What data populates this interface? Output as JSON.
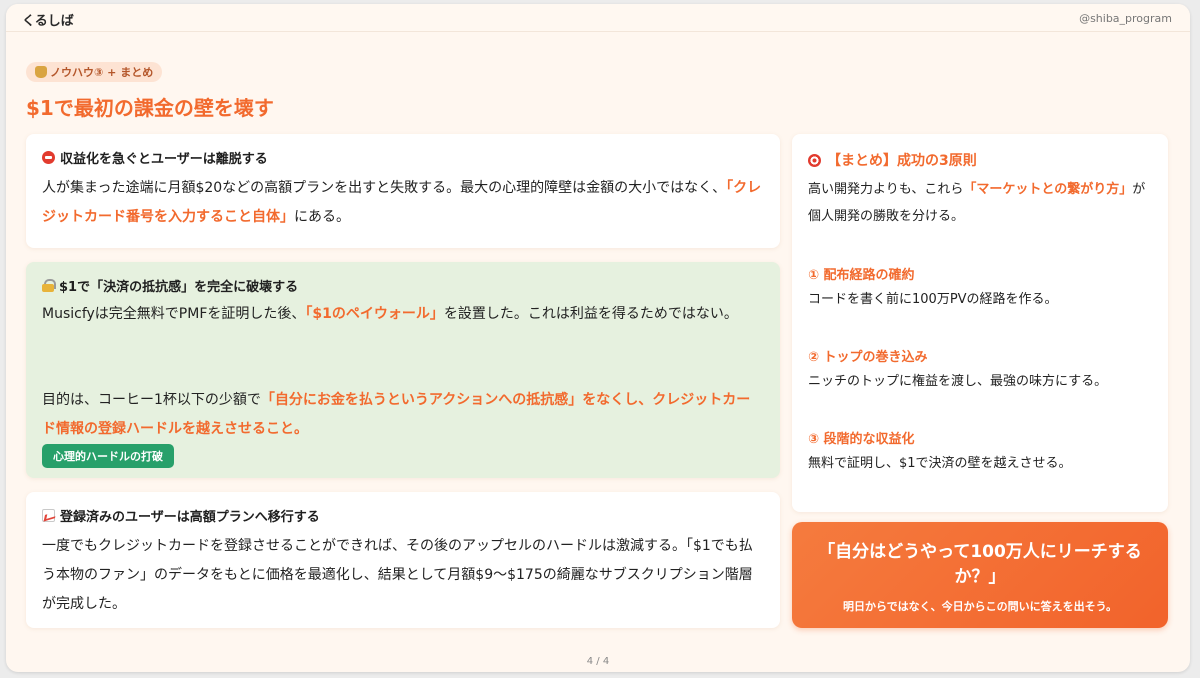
{
  "app": {
    "brand": "くるしば",
    "handle": "@shiba_program"
  },
  "header": {
    "tag_icon": "money-bag-icon",
    "tag": "ノウハウ③ + まとめ",
    "title": "$1で最初の課金の壁を壊す"
  },
  "cards": {
    "c1": {
      "icon": "no-entry-icon",
      "heading": "収益化を急ぐとユーザーは離脱する",
      "p1": "人が集まった途端に月額$20などの高額プランを出すと失敗する。最大の心理的障壁は金額の大小ではなく、",
      "hl": "「クレジットカード番号を入力すること自体」",
      "p2": "にある。"
    },
    "c2": {
      "icon": "lock-icon",
      "heading": "$1で「決済の抵抗感」を完全に破壊する",
      "a1": "Musicfyは完全無料でPMFを証明した後、",
      "a_hl": "「$1のペイウォール」",
      "a2": "を設置した。これは利益を得るためではない。",
      "b1": "目的は、コーヒー1杯以下の少額で",
      "b_hl": "「自分にお金を払うというアクションへの抵抗感」をなくし、クレジットカード情報の登録ハードルを越えさせること。",
      "badge": "心理的ハードルの打破"
    },
    "c3": {
      "icon": "chart-up-icon",
      "heading": "登録済みのユーザーは高額プランへ移行する",
      "text": "一度でもクレジットカードを登録させることができれば、その後のアップセルのハードルは激減する。「$1でも払う本物のファン」のデータをもとに価格を最適化し、結果として月額$9〜$175の綺麗なサブスクリプション階層が完成した。"
    }
  },
  "summary": {
    "icon": "target-icon",
    "heading": "【まとめ】成功の3原則",
    "intro1": "高い開発力よりも、これら",
    "intro_hl": "「マーケットとの繋がり方」",
    "intro2": "が個人開発の勝敗を分ける。",
    "items": [
      {
        "title": "① 配布経路の確約",
        "text": "コードを書く前に100万PVの経路を作る。"
      },
      {
        "title": "② トップの巻き込み",
        "text": "ニッチのトップに権益を渡し、最強の味方にする。"
      },
      {
        "title": "③ 段階的な収益化",
        "text": "無料で証明し、$1で決済の壁を越えさせる。"
      }
    ]
  },
  "cta": {
    "question": "「自分はどうやって100万人にリーチするか？」",
    "sub": "明日からではなく、今日からこの問いに答えを出そう。"
  },
  "pager": "4 / 4",
  "colors": {
    "accent": "#f26a2e",
    "badge_green": "#27a06a",
    "background": "#fff7f0"
  }
}
